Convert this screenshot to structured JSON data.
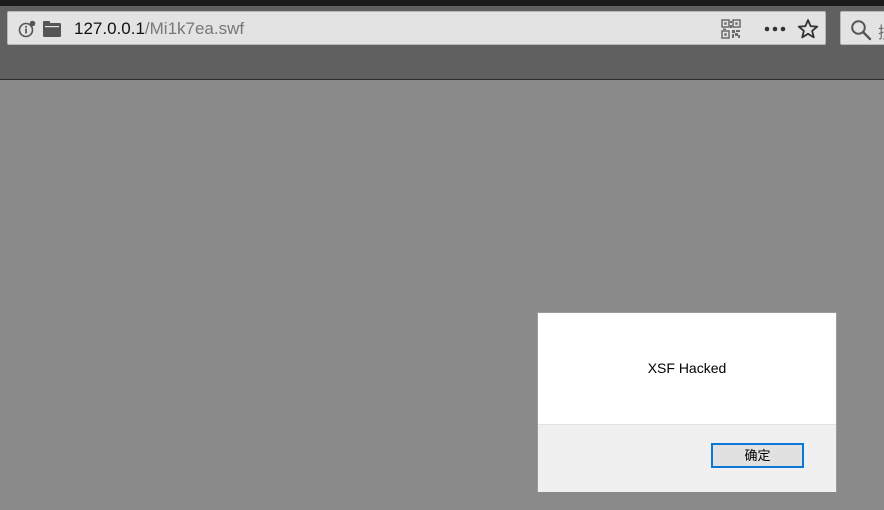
{
  "browser": {
    "url_host": "127.0.0.1",
    "url_path": "/Mi1k7ea.swf",
    "search_placeholder": "搜"
  },
  "icons": {
    "site_info": "info-icon",
    "page": "page-icon",
    "qr_code": "qr-code-icon",
    "more": "more-icon",
    "bookmark": "star-icon",
    "search": "search-icon"
  },
  "dialog": {
    "message": "XSF Hacked",
    "ok_label": "确定"
  },
  "colors": {
    "page_background": "#8a8a8a",
    "toolbar": "#606060",
    "dialog_button_border": "#0a78d7"
  }
}
